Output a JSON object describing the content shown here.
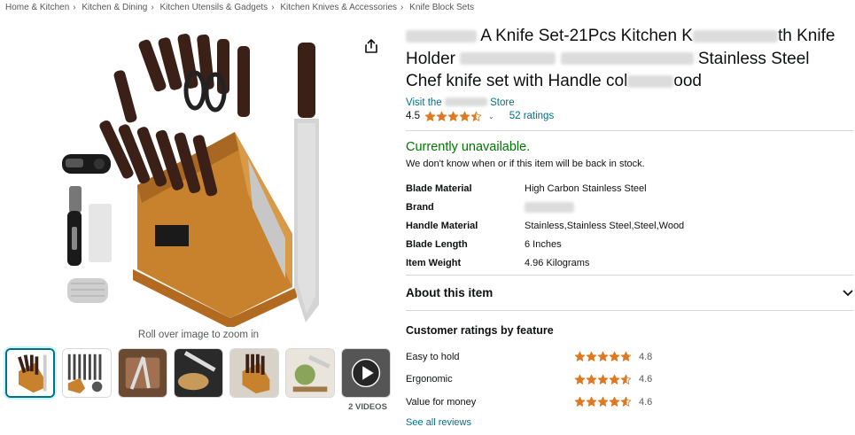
{
  "breadcrumb": [
    "Home & Kitchen",
    "Kitchen & Dining",
    "Kitchen Utensils & Gadgets",
    "Kitchen Knives & Accessories",
    "Knife Block Sets"
  ],
  "gallery": {
    "zoom_hint": "Roll over image to zoom in",
    "video_label": "2 VIDEOS",
    "thumbnails": [
      "knife-block-set",
      "knife-set-contents",
      "knife-in-use",
      "knife-cutting-bread",
      "knife-block-kitchen",
      "knife-cutting-food",
      "video-play"
    ]
  },
  "product": {
    "title_line1_suffix": "A Knife Set-21Pcs Kitchen K",
    "title_line1_tail": "th Knife",
    "title_line2_prefix": "Holder",
    "title_line2_tail": "Stainless Steel",
    "title_line3": "Chef knife set with Handle col",
    "title_line3_tail": "ood",
    "store_prefix": "Visit the",
    "store_suffix": "Store",
    "rating": "4.5",
    "ratings_count": "52 ratings",
    "stars_value": 4.5
  },
  "availability": {
    "status": "Currently unavailable.",
    "note": "We don't know when or if this item will be back in stock."
  },
  "specs": [
    {
      "key": "Blade Material",
      "value": "High Carbon Stainless Steel"
    },
    {
      "key": "Brand",
      "value": ""
    },
    {
      "key": "Handle Material",
      "value": "Stainless,Stainless Steel,Steel,Wood"
    },
    {
      "key": "Blade Length",
      "value": "6 Inches"
    },
    {
      "key": "Item Weight",
      "value": "4.96 Kilograms"
    }
  ],
  "about": {
    "title": "About this item"
  },
  "features": {
    "title": "Customer ratings by feature",
    "items": [
      {
        "name": "Easy to hold",
        "score": "4.8",
        "stars": 4.8
      },
      {
        "name": "Ergonomic",
        "score": "4.6",
        "stars": 4.6
      },
      {
        "name": "Value for money",
        "score": "4.6",
        "stars": 4.6
      }
    ],
    "see_all": "See all reviews"
  },
  "colors": {
    "link": "#007185",
    "star": "#de7921",
    "available": "#007600"
  }
}
